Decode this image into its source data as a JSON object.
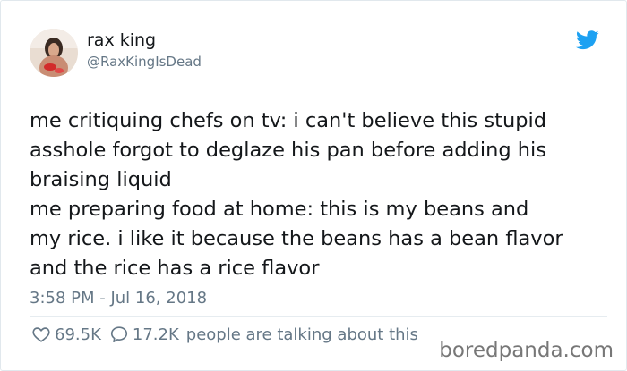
{
  "tweet": {
    "display_name": "rax king",
    "handle": "@RaxKingIsDead",
    "lines": [
      "me critiquing chefs on tv: i can't believe this stupid",
      "asshole forgot to deglaze his pan before adding his",
      "braising liquid",
      "me preparing food at home: this is my beans and",
      "my rice. i like it because the beans has a bean flavor",
      "and the rice has a rice flavor"
    ],
    "timestamp": "3:58 PM - Jul 16, 2018",
    "likes": "69.5K",
    "replies": "17.2K",
    "talking_label": "people are talking about this"
  },
  "watermark": "boredpanda.com",
  "icons": {
    "avatar": "avatar-photo",
    "brand": "twitter-bird-icon",
    "like": "heart-icon",
    "reply": "speech-bubble-icon"
  },
  "colors": {
    "twitter_blue": "#1da1f2",
    "text": "#14171a",
    "muted": "#657786"
  }
}
